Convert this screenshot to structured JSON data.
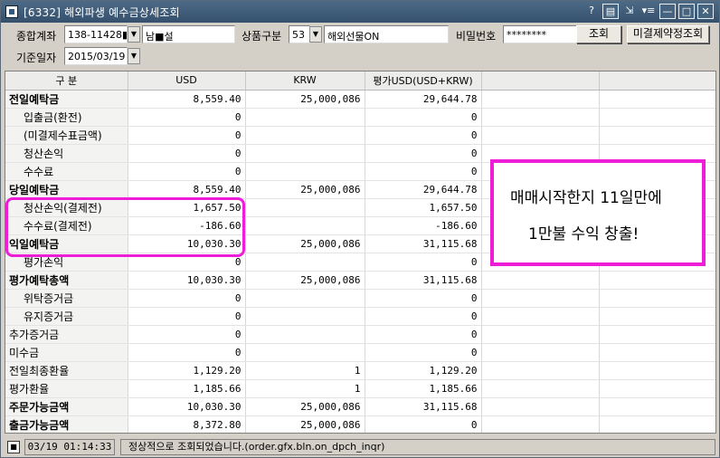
{
  "window": {
    "title": "[6332] 해외파생 예수금상세조회",
    "controls": [
      "?",
      "▤",
      "⇲",
      "▾≡",
      "—",
      "□",
      "✕"
    ]
  },
  "filters": {
    "account_label": "종합계좌",
    "account_value": "138-11428■",
    "account_name": "남■설",
    "product_label": "상품구분",
    "product_code": "53",
    "product_name": "해외선물ON",
    "password_label": "비밀번호",
    "password_value": "********",
    "search_button": "조회",
    "unsettled_button": "미결제약정조회",
    "date_label": "기준일자",
    "date_value": "2015/03/19"
  },
  "table": {
    "headers": [
      "구  분",
      "USD",
      "KRW",
      "평가USD(USD+KRW)",
      "",
      ""
    ],
    "rows": [
      {
        "label": "전일예탁금",
        "usd": "8,559.40",
        "krw": "25,000,086",
        "eval": "29,644.78",
        "style": "bold"
      },
      {
        "label": "입출금(환전)",
        "usd": "0",
        "krw": "",
        "eval": "0",
        "style": "sub"
      },
      {
        "label": "(미결제수표금액)",
        "usd": "0",
        "krw": "",
        "eval": "0",
        "style": "sub"
      },
      {
        "label": "청산손익",
        "usd": "0",
        "krw": "",
        "eval": "0",
        "style": "sub"
      },
      {
        "label": "수수료",
        "usd": "0",
        "krw": "",
        "eval": "0",
        "style": "sub"
      },
      {
        "label": "당일예탁금",
        "usd": "8,559.40",
        "krw": "25,000,086",
        "eval": "29,644.78",
        "style": "bold"
      },
      {
        "label": "청산손익(결제전)",
        "usd": "1,657.50",
        "krw": "",
        "eval": "1,657.50",
        "style": "sub"
      },
      {
        "label": "수수료(결제전)",
        "usd": "-186.60",
        "krw": "",
        "eval": "-186.60",
        "style": "sub"
      },
      {
        "label": "익일예탁금",
        "usd": "10,030.30",
        "krw": "25,000,086",
        "eval": "31,115.68",
        "style": "bold"
      },
      {
        "label": "평가손익",
        "usd": "0",
        "krw": "",
        "eval": "0",
        "style": "sub"
      },
      {
        "label": "평가예탁총액",
        "usd": "10,030.30",
        "krw": "25,000,086",
        "eval": "31,115.68",
        "style": "bold"
      },
      {
        "label": "위탁증거금",
        "usd": "0",
        "krw": "",
        "eval": "0",
        "style": "sub"
      },
      {
        "label": "유지증거금",
        "usd": "0",
        "krw": "",
        "eval": "0",
        "style": "sub"
      },
      {
        "label": "추가증거금",
        "usd": "0",
        "krw": "",
        "eval": "0",
        "style": ""
      },
      {
        "label": "미수금",
        "usd": "0",
        "krw": "",
        "eval": "0",
        "style": ""
      },
      {
        "label": "전일최종환율",
        "usd": "1,129.20",
        "krw": "1",
        "eval": "1,129.20",
        "style": ""
      },
      {
        "label": "평가환율",
        "usd": "1,185.66",
        "krw": "1",
        "eval": "1,185.66",
        "style": ""
      },
      {
        "label": "주문가능금액",
        "usd": "10,030.30",
        "krw": "25,000,086",
        "eval": "31,115.68",
        "style": "bold"
      },
      {
        "label": "출금가능금액",
        "usd": "8,372.80",
        "krw": "25,000,086",
        "eval": "0",
        "style": "bold"
      }
    ]
  },
  "annotation": {
    "line1": "매매시작한지 11일만에",
    "line2": "1만불 수익 창출!",
    "color": "#ee1dd8"
  },
  "status": {
    "time": "03/19 01:14:33",
    "message": "정상적으로 조회되었습니다.(order.gfx.bln.on_dpch_inqr)"
  }
}
